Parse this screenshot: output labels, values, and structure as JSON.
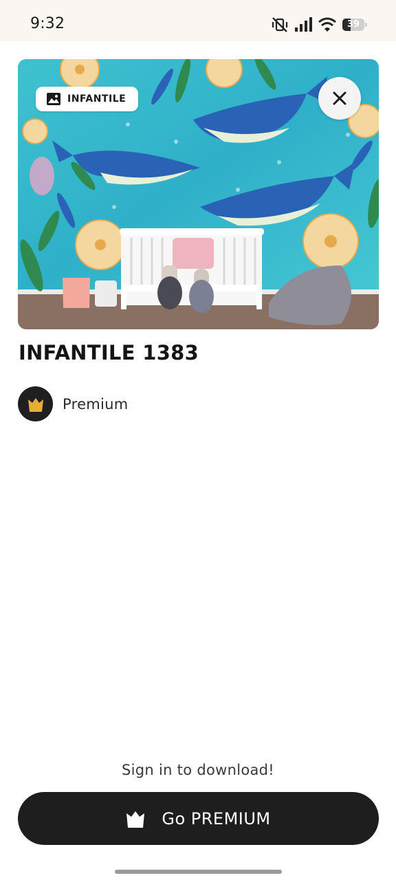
{
  "status_bar": {
    "time": "9:32",
    "battery_level": "39",
    "battery_fraction": 0.39,
    "icons": [
      "vibrate-off-icon",
      "cellular-signal-icon",
      "wifi-icon",
      "battery-icon"
    ]
  },
  "hero": {
    "category_chip": {
      "icon": "image-icon",
      "label": "INFANTILE"
    },
    "close_icon": "close-icon"
  },
  "item": {
    "title": "INFANTILE 1383",
    "tier_icon": "crown-icon",
    "tier_label": "Premium"
  },
  "footer": {
    "signin_text": "Sign in to download!",
    "cta_icon": "crown-icon",
    "cta_label": "Go PREMIUM"
  },
  "colors": {
    "accent_gold": "#e6b038",
    "button_dark": "#1e1e1e",
    "status_bar_bg": "#fbf6f2"
  }
}
